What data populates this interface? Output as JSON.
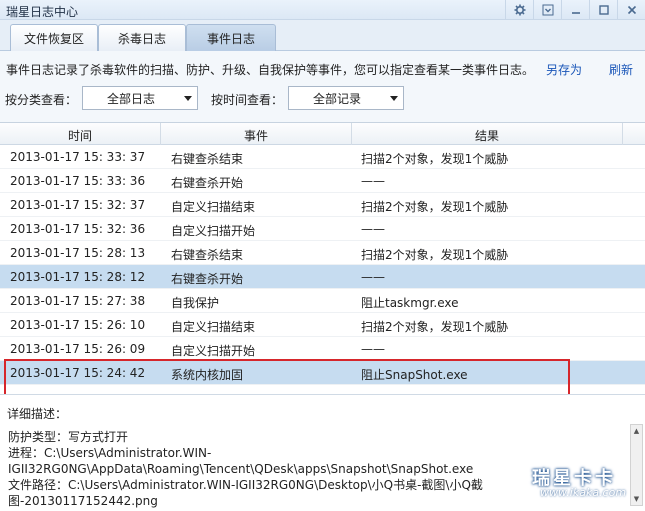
{
  "window": {
    "title": "瑞星日志中心",
    "controls": [
      "gear-icon",
      "menu-icon",
      "minimize-icon",
      "maximize-icon",
      "close-icon"
    ]
  },
  "tabs": [
    {
      "label": "文件恢复区"
    },
    {
      "label": "杀毒日志"
    },
    {
      "label": "事件日志",
      "active": true
    }
  ],
  "description": "事件日志记录了杀毒软件的扫描、防护、升级、自我保护等事件，您可以指定查看某一类事件日志。",
  "actions": {
    "save_as": "另存为",
    "refresh": "刷新"
  },
  "filters": {
    "category_label": "按分类查看：",
    "category_value": "全部日志",
    "time_label": "按时间查看：",
    "time_value": "全部记录"
  },
  "table": {
    "columns": [
      "时间",
      "事件",
      "结果"
    ],
    "rows": [
      {
        "time": "2013-01-17 15: 33: 37",
        "event": "右键查杀结束",
        "result": "扫描2个对象，发现1个威胁"
      },
      {
        "time": "2013-01-17 15: 33: 36",
        "event": "右键查杀开始",
        "result": "——"
      },
      {
        "time": "2013-01-17 15: 32: 37",
        "event": "自定义扫描结束",
        "result": "扫描2个对象，发现1个威胁"
      },
      {
        "time": "2013-01-17 15: 32: 36",
        "event": "自定义扫描开始",
        "result": "——"
      },
      {
        "time": "2013-01-17 15: 28: 13",
        "event": "右键查杀结束",
        "result": "扫描2个对象，发现1个威胁"
      },
      {
        "time": "2013-01-17 15: 28: 12",
        "event": "右键查杀开始",
        "result": "——",
        "selected": true
      },
      {
        "time": "2013-01-17 15: 27: 38",
        "event": "自我保护",
        "result": "阻止taskmgr.exe"
      },
      {
        "time": "2013-01-17 15: 26: 10",
        "event": "自定义扫描结束",
        "result": "扫描2个对象，发现1个威胁"
      },
      {
        "time": "2013-01-17 15: 26: 09",
        "event": "自定义扫描开始",
        "result": "——"
      },
      {
        "time": "2013-01-17 15: 24: 42",
        "event": "系统内核加固",
        "result": "阻止SnapShot.exe",
        "selected": true
      }
    ]
  },
  "detail": {
    "label": "详细描述：",
    "lines": [
      "防护类型：写方式打开",
      "进程：C:\\Users\\Administrator.WIN-IGII32RG0NG\\AppData\\Roaming\\Tencent\\QDesk\\apps\\Snapshot\\SnapShot.exe",
      "文件路径：C:\\Users\\Administrator.WIN-IGII32RG0NG\\Desktop\\小Q书桌-截图\\小Q截图-20130117152442.png"
    ]
  },
  "watermark": {
    "brand": "瑞星卡卡",
    "site": "www.ikaka.com"
  },
  "colors": {
    "selected_row": "#c6dcf0",
    "link": "#1a56b8",
    "highlight_box": "#d6262b"
  }
}
